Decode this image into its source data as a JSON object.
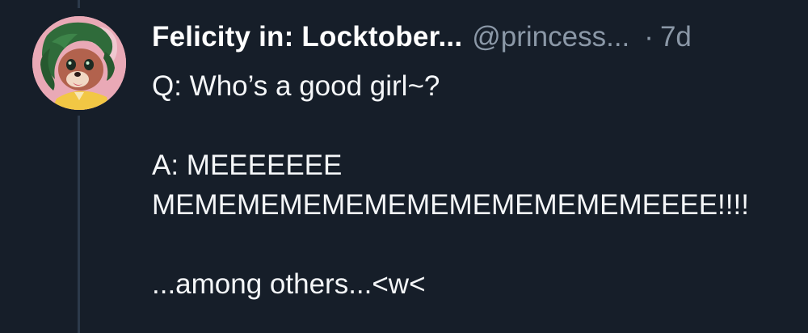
{
  "post": {
    "author": {
      "display_name": "Felicity in: Locktober...",
      "handle": "@princess...",
      "avatar": "avatar-image"
    },
    "separator": "·",
    "timestamp": "7d",
    "lines": [
      "Q: Who’s a good girl~?",
      "",
      "A: MEEEEEEE",
      "MEMEMEMEMEMEMEMEMEMEMEMEEEE!!!!",
      "",
      "...among others...<w<"
    ]
  },
  "colors": {
    "background": "#161e29",
    "thread_line": "#2c3a4b",
    "muted_text": "#8b98a7",
    "primary_text": "#ffffff"
  }
}
